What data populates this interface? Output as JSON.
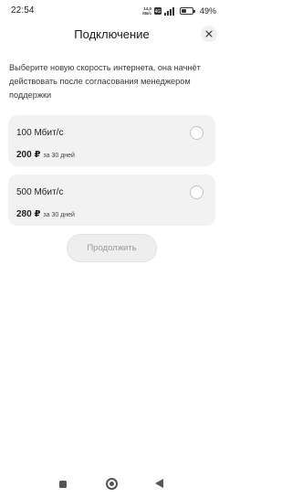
{
  "status_bar": {
    "time": "22:54",
    "net_speed_value": "14,0",
    "net_speed_unit": "КБ/с",
    "signal_label": "4G+",
    "battery_percent": "49%",
    "battery_level": 0.49
  },
  "header": {
    "title": "Подключение",
    "close_icon": "close-icon"
  },
  "description": "Выберите новую скорость интернета, она начнёт действовать после согласования менеджером поддержки",
  "plans": [
    {
      "speed": "100 Мбит/с",
      "price": "200 ₽",
      "period": "за 30 дней",
      "selected": false
    },
    {
      "speed": "500 Мбит/с",
      "price": "280 ₽",
      "period": "за 30 дней",
      "selected": false
    }
  ],
  "continue_button": {
    "label": "Продолжить",
    "enabled": false
  },
  "nav_bar": {
    "recents_icon": "square-icon",
    "home_icon": "circle-icon",
    "back_icon": "triangle-back-icon"
  },
  "colors": {
    "card_bg": "#f2f2f2",
    "disabled_text": "#9a9a9a",
    "radio_border": "#c4c4c4"
  }
}
